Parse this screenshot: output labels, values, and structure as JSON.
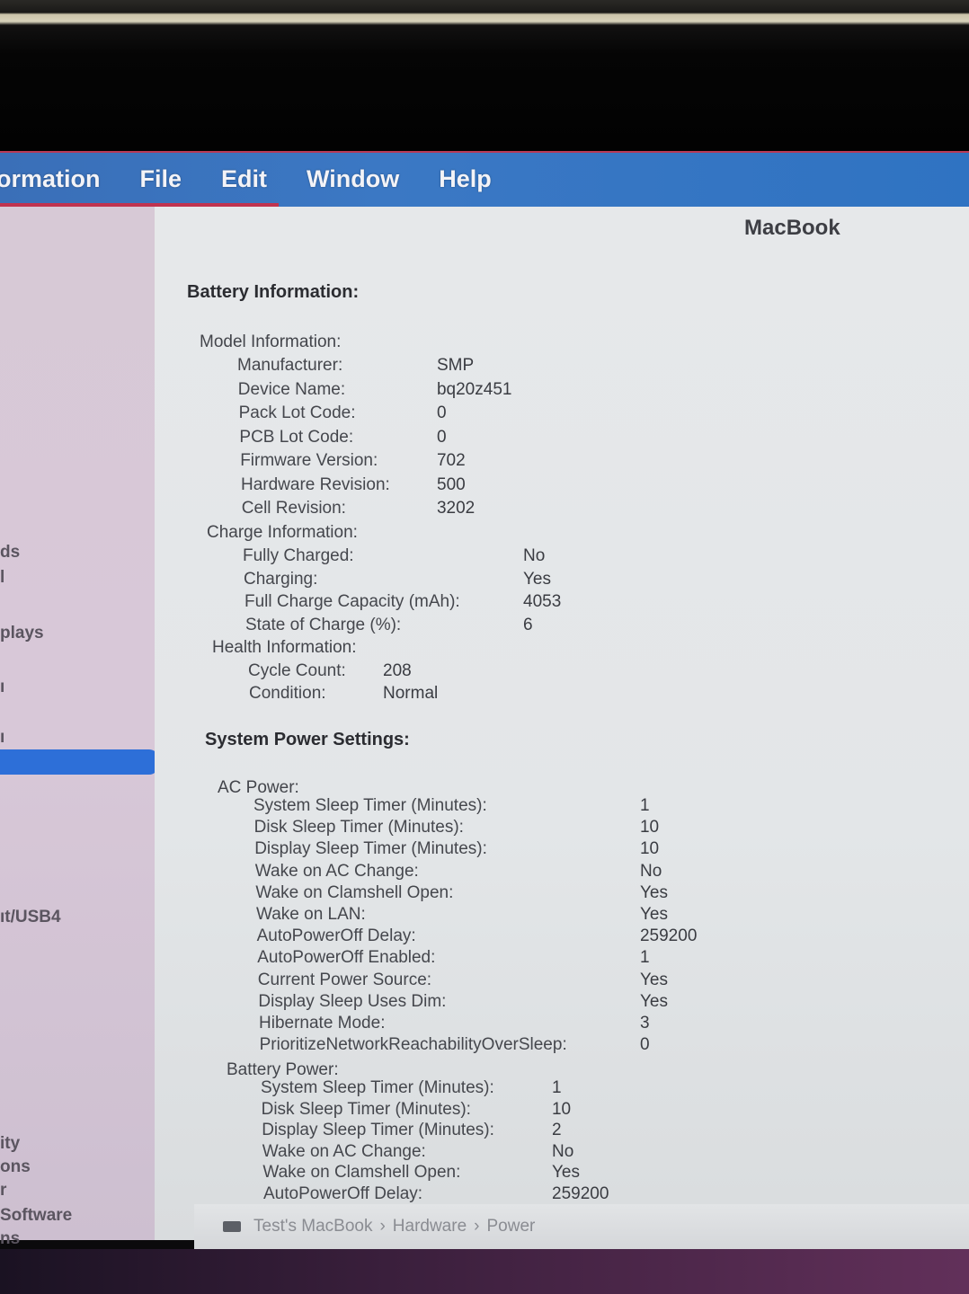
{
  "menubar": {
    "app_label": "ormation",
    "items": [
      "File",
      "Edit",
      "Window",
      "Help"
    ]
  },
  "sidebar": {
    "items": [
      {
        "label": "ds"
      },
      {
        "label": "l"
      },
      {
        "label": "plays"
      },
      {
        "label": "ı"
      },
      {
        "label": "ı"
      },
      {
        "label": "ıt/USB4"
      },
      {
        "label": "ity"
      },
      {
        "label": "ons"
      },
      {
        "label": "r"
      },
      {
        "label": "Software"
      },
      {
        "label": "ns"
      }
    ]
  },
  "content": {
    "machine_title": "MacBook",
    "battery": {
      "title": "Battery Information:",
      "model_label": "Model Information:",
      "model": [
        {
          "key": "Manufacturer:",
          "value": "SMP"
        },
        {
          "key": "Device Name:",
          "value": "bq20z451"
        },
        {
          "key": "Pack Lot Code:",
          "value": "0"
        },
        {
          "key": "PCB Lot Code:",
          "value": "0"
        },
        {
          "key": "Firmware Version:",
          "value": "702"
        },
        {
          "key": "Hardware Revision:",
          "value": "500"
        },
        {
          "key": "Cell Revision:",
          "value": "3202"
        }
      ],
      "charge_label": "Charge Information:",
      "charge": [
        {
          "key": "Fully Charged:",
          "value": "No"
        },
        {
          "key": "Charging:",
          "value": "Yes"
        },
        {
          "key": "Full Charge Capacity (mAh):",
          "value": "4053"
        },
        {
          "key": "State of Charge (%):",
          "value": "6"
        }
      ],
      "health_label": "Health Information:",
      "health": [
        {
          "key": "Cycle Count:",
          "value": "208"
        },
        {
          "key": "Condition:",
          "value": "Normal"
        }
      ]
    },
    "power": {
      "title": "System Power Settings:",
      "ac_label": "AC Power:",
      "ac": [
        {
          "key": "System Sleep Timer (Minutes):",
          "value": "1"
        },
        {
          "key": "Disk Sleep Timer (Minutes):",
          "value": "10"
        },
        {
          "key": "Display Sleep Timer (Minutes):",
          "value": "10"
        },
        {
          "key": "Wake on AC Change:",
          "value": "No"
        },
        {
          "key": "Wake on Clamshell Open:",
          "value": "Yes"
        },
        {
          "key": "Wake on LAN:",
          "value": "Yes"
        },
        {
          "key": "AutoPowerOff Delay:",
          "value": "259200"
        },
        {
          "key": "AutoPowerOff Enabled:",
          "value": "1"
        },
        {
          "key": "Current Power Source:",
          "value": "Yes"
        },
        {
          "key": "Display Sleep Uses Dim:",
          "value": "Yes"
        },
        {
          "key": "Hibernate Mode:",
          "value": "3"
        },
        {
          "key": "PrioritizeNetworkReachabilityOverSleep:",
          "value": "0"
        }
      ],
      "battery_label": "Battery Power:",
      "battery": [
        {
          "key": "System Sleep Timer (Minutes):",
          "value": "1"
        },
        {
          "key": "Disk Sleep Timer (Minutes):",
          "value": "10"
        },
        {
          "key": "Display Sleep Timer (Minutes):",
          "value": "2"
        },
        {
          "key": "Wake on AC Change:",
          "value": "No"
        },
        {
          "key": "Wake on Clamshell Open:",
          "value": "Yes"
        },
        {
          "key": "AutoPowerOff Delay:",
          "value": "259200"
        }
      ]
    }
  },
  "breadcrumb": {
    "device": "Test's MacBook",
    "sep": "›",
    "level1": "Hardware",
    "level2": "Power"
  }
}
